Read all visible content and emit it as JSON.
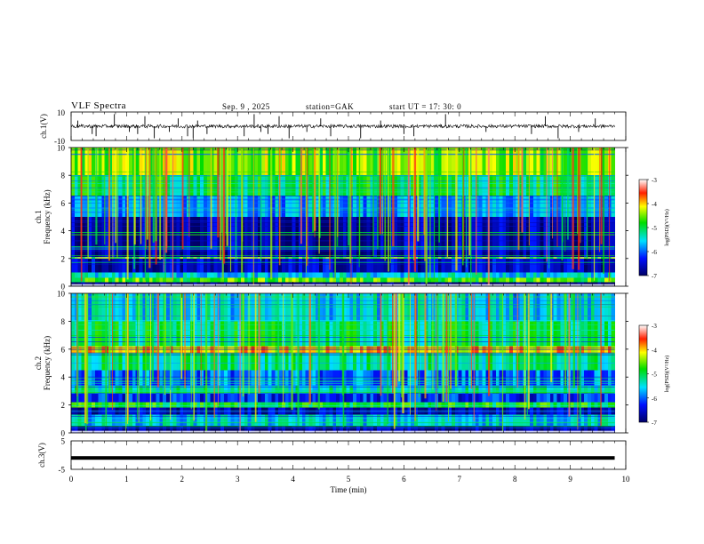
{
  "header": {
    "title": "VLF  Spectra",
    "date": "Sep. 9   , 2025",
    "station": "station=GAK",
    "start": "start  UT  =    17: 30: 0"
  },
  "chart_data": [
    {
      "type": "line",
      "panel": "ch1-waveform",
      "ylabel": "ch.1(V)",
      "ylim": [
        -10,
        10
      ],
      "y_ticks": [
        "10",
        "-10"
      ],
      "baseline": 0,
      "x_range": [
        0,
        10
      ],
      "data_extent_min": 9.8,
      "spike_times_min": [
        0.12,
        0.38,
        0.45,
        0.78,
        1.05,
        1.2,
        1.33,
        1.5,
        1.77,
        1.93,
        2.1,
        2.2,
        2.28,
        2.45,
        3.12,
        3.3,
        3.42,
        3.55,
        3.75,
        3.93,
        4.25,
        4.5,
        4.68,
        5.22,
        5.58,
        6.0,
        6.18,
        6.75,
        7.48,
        8.3,
        8.55,
        8.78,
        9.15,
        9.45
      ]
    },
    {
      "type": "heatmap",
      "panel": "ch1-spectrogram",
      "ylabel": "Frequency  (kHz)",
      "channel_label": "ch.1",
      "x_range": [
        0,
        10
      ],
      "y_range": [
        0,
        10
      ],
      "y_ticks": [
        "0",
        "2",
        "4",
        "6",
        "8",
        "10"
      ],
      "colorbar": {
        "label": "log(PSD)(V²/Hz)",
        "ticks": [
          "-3",
          "-4",
          "-5",
          "-6",
          "-7"
        ],
        "range": [
          -7,
          -3
        ]
      },
      "bands_khz_log_psd": [
        {
          "from": 0.0,
          "to": 0.3,
          "level": -7.0
        },
        {
          "from": 0.3,
          "to": 0.6,
          "level": -4.8
        },
        {
          "from": 0.6,
          "to": 1.0,
          "level": -5.6
        },
        {
          "from": 1.0,
          "to": 2.0,
          "level": -6.6
        },
        {
          "from": 2.0,
          "to": 2.1,
          "level": -4.6
        },
        {
          "from": 2.1,
          "to": 5.0,
          "level": -6.7
        },
        {
          "from": 5.0,
          "to": 6.5,
          "level": -5.8
        },
        {
          "from": 6.5,
          "to": 8.0,
          "level": -5.1
        },
        {
          "from": 8.0,
          "to": 10.0,
          "level": -4.6
        }
      ]
    },
    {
      "type": "heatmap",
      "panel": "ch2-spectrogram",
      "ylabel": "Frequency  (kHz)",
      "channel_label": "ch.2",
      "x_range": [
        0,
        10
      ],
      "y_range": [
        0,
        10
      ],
      "y_ticks": [
        "0",
        "2",
        "4",
        "6",
        "8",
        "10"
      ],
      "colorbar": {
        "label": "log(PSD)(V²/Hz)",
        "ticks": [
          "-3",
          "-4",
          "-5",
          "-6",
          "-7"
        ],
        "range": [
          -7,
          -3
        ]
      },
      "bands_khz_log_psd": [
        {
          "from": 0.0,
          "to": 0.5,
          "level": -6.8
        },
        {
          "from": 0.5,
          "to": 1.3,
          "level": -5.6
        },
        {
          "from": 1.3,
          "to": 1.8,
          "level": -6.7
        },
        {
          "from": 1.8,
          "to": 2.2,
          "level": -5.0
        },
        {
          "from": 2.2,
          "to": 2.8,
          "level": -6.3
        },
        {
          "from": 2.8,
          "to": 3.4,
          "level": -5.4
        },
        {
          "from": 3.4,
          "to": 4.5,
          "level": -6.0
        },
        {
          "from": 4.5,
          "to": 5.7,
          "level": -5.3
        },
        {
          "from": 5.7,
          "to": 6.2,
          "level": -4.2
        },
        {
          "from": 6.2,
          "to": 8.0,
          "level": -5.2
        },
        {
          "from": 8.0,
          "to": 10.0,
          "level": -5.6
        }
      ]
    },
    {
      "type": "line",
      "panel": "ch3-waveform",
      "ylabel": "ch.3(V)",
      "ylim": [
        -5,
        5
      ],
      "y_ticks": [
        "5",
        "-5"
      ],
      "level_v": -1.0,
      "x_range": [
        0,
        10
      ],
      "x_ticks": [
        "0",
        "1",
        "2",
        "3",
        "4",
        "5",
        "6",
        "7",
        "8",
        "9",
        "10"
      ],
      "xlabel": "Time  (min)"
    }
  ]
}
